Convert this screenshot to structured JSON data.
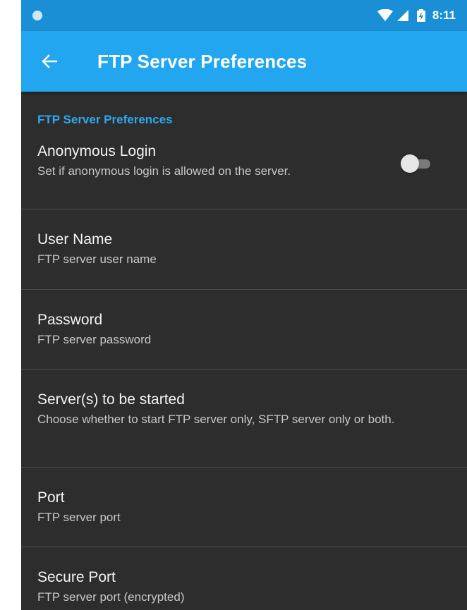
{
  "status_bar": {
    "time": "8:11",
    "icons": [
      "notification-dot-icon",
      "wifi-icon",
      "signal-icon",
      "battery-charging-icon"
    ]
  },
  "app_bar": {
    "title": "FTP Server Preferences",
    "back_icon": "arrow-left-icon"
  },
  "category": {
    "title": "FTP Server Preferences"
  },
  "preferences": [
    {
      "title": "Anonymous Login",
      "summary": "Set if anonymous login is allowed on the server.",
      "toggle_on": false
    },
    {
      "title": "User Name",
      "summary": "FTP server user name"
    },
    {
      "title": "Password",
      "summary": "FTP server password"
    },
    {
      "title": "Server(s) to be started",
      "summary": "Choose whether to start FTP server only, SFTP server only or both."
    },
    {
      "title": "Port",
      "summary": "FTP server port"
    },
    {
      "title": "Secure Port",
      "summary": "FTP server port (encrypted)"
    }
  ],
  "colors": {
    "status_bar": "#1b8fd6",
    "app_bar": "#22a6f0",
    "background": "#2d2d2d",
    "accent": "#2ea8ee"
  }
}
